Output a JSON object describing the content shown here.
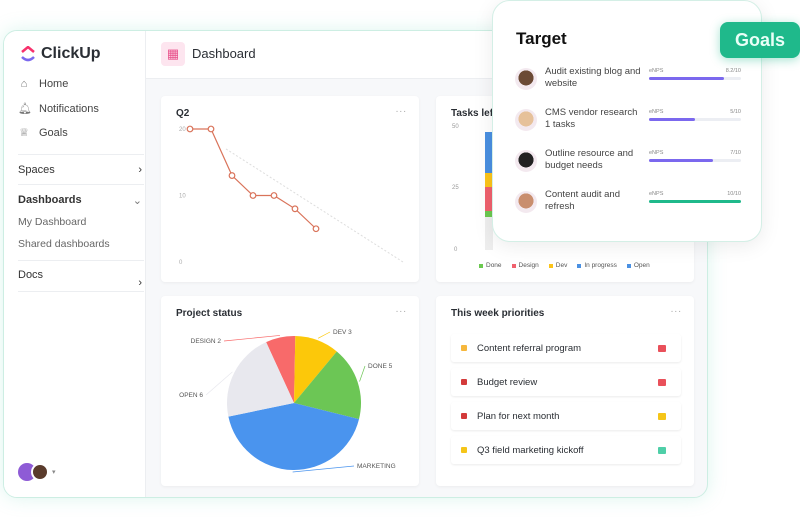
{
  "brand": "ClickUp",
  "sidebar": {
    "nav": [
      {
        "label": "Home",
        "icon": "home-icon"
      },
      {
        "label": "Notifications",
        "icon": "bell-icon"
      },
      {
        "label": "Goals",
        "icon": "trophy-icon"
      }
    ],
    "spaces": "Spaces",
    "dashboards": "Dashboards",
    "dashboard_items": [
      "My Dashboard",
      "Shared dashboards"
    ],
    "docs": "Docs"
  },
  "header": {
    "title": "Dashboard"
  },
  "q2": {
    "title": "Q2",
    "more": "..."
  },
  "tasks_left": {
    "title": "Tasks left",
    "ticks": [
      "50",
      "25",
      "0"
    ],
    "legend": [
      {
        "label": "Done",
        "color": "#6bc950"
      },
      {
        "label": "Design",
        "color": "#f0616e"
      },
      {
        "label": "Dev",
        "color": "#fcc419"
      },
      {
        "label": "In progress",
        "color": "#4a90e2"
      },
      {
        "label": "Open",
        "color": "#4a90e2"
      }
    ]
  },
  "project_status": {
    "title": "Project status",
    "more": "..."
  },
  "priorities": {
    "title": "This week priorities",
    "more": "...",
    "items": [
      {
        "label": "Content referral program",
        "status_color": "#f6b73c",
        "flag_color": "#e9505a"
      },
      {
        "label": "Budget review",
        "status_color": "#d33a3a",
        "flag_color": "#e9505a"
      },
      {
        "label": "Plan for next month",
        "status_color": "#d33a3a",
        "flag_color": "#f5c518"
      },
      {
        "label": "Q3 field marketing kickoff",
        "status_color": "#f5c518",
        "flag_color": "#4fcfa8"
      }
    ]
  },
  "goals_panel": {
    "badge": "Goals",
    "title": "Target",
    "items": [
      {
        "text": "Audit existing blog and website",
        "metric": "eNPS",
        "value": "8.2/10",
        "progress": 0.82,
        "color": "#7b68ee"
      },
      {
        "text": "CMS vendor research 1 tasks",
        "metric": "eNPS",
        "value": "5/10",
        "progress": 0.5,
        "color": "#7b68ee"
      },
      {
        "text": "Outline resource and budget needs",
        "metric": "eNPS",
        "value": "7/10",
        "progress": 0.7,
        "color": "#7b68ee"
      },
      {
        "text": "Content audit and refresh",
        "metric": "eNPS",
        "value": "10/10",
        "progress": 1.0,
        "color": "#1fb98b"
      }
    ]
  },
  "chart_data": [
    {
      "type": "line",
      "title": "Q2",
      "yticks": [
        "20",
        "10",
        "0"
      ],
      "ylim": [
        0,
        20
      ],
      "series": [
        {
          "values": [
            20,
            20,
            13,
            10,
            10,
            8,
            5
          ],
          "color": "#d9735a"
        }
      ],
      "ideal": {
        "from": 17,
        "to": 0
      }
    },
    {
      "type": "pie",
      "title": "Project status",
      "slices": [
        {
          "label": "DESIGN 2",
          "value": 2,
          "color": "#f86a6a"
        },
        {
          "label": "DEV 3",
          "value": 3,
          "color": "#fcc80a"
        },
        {
          "label": "DONE 5",
          "value": 5,
          "color": "#6cc655"
        },
        {
          "label": "MARKETING",
          "value": 12,
          "color": "#4a94ee"
        },
        {
          "label": "OPEN 6",
          "value": 6,
          "color": "#e8e8ee"
        }
      ]
    }
  ]
}
